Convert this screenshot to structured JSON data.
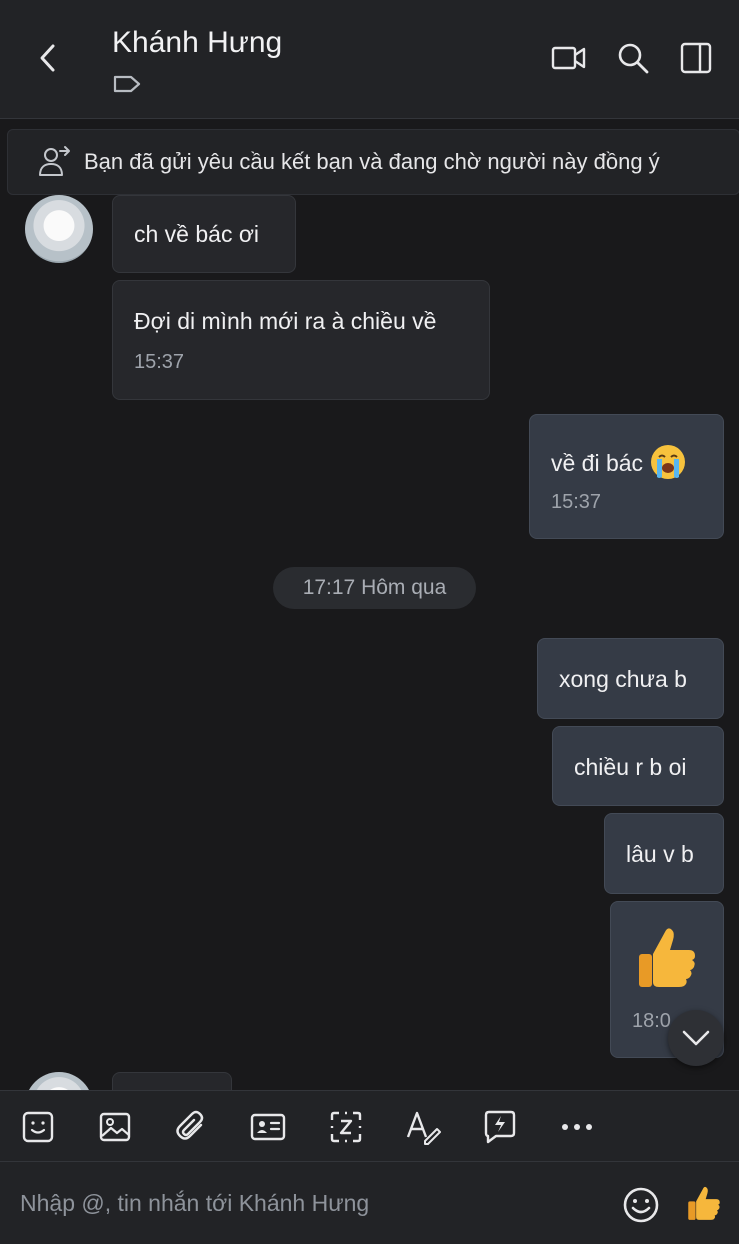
{
  "header": {
    "title": "Khánh Hưng",
    "icons": [
      "back-icon",
      "tag-icon",
      "video-call-icon",
      "search-icon",
      "side-panel-icon"
    ]
  },
  "notice": {
    "text": "Bạn đã gửi yêu cầu kết bạn và đang chờ người này đồng ý"
  },
  "messages": [
    {
      "direction": "incoming",
      "text": "ch về bác ơi"
    },
    {
      "direction": "incoming",
      "text": "Đợi di mình mới ra à chiều về",
      "time": "15:37"
    },
    {
      "direction": "outgoing",
      "text": "về đi bác",
      "emoji": "loudly-crying-face",
      "time": "15:37"
    },
    {
      "direction": "outgoing",
      "text": "xong chưa b"
    },
    {
      "direction": "outgoing",
      "text": "chiều r b oi"
    },
    {
      "direction": "outgoing",
      "text": "lâu v b"
    },
    {
      "direction": "outgoing",
      "emoji": "thumbs-up",
      "time": "18:0"
    }
  ],
  "date_separator": "17:17 Hôm qua",
  "toolbar": {
    "items": [
      "sticker-icon",
      "image-icon",
      "attachment-icon",
      "contact-card-icon",
      "screenshot-icon",
      "text-format-icon",
      "quick-message-icon",
      "more-icon"
    ]
  },
  "composer": {
    "placeholder": "Nhập @, tin nhắn tới Khánh Hưng"
  },
  "colors": {
    "background": "#19191b",
    "header": "#222326",
    "incoming_bubble": "#26272b",
    "outgoing_bubble": "#353b46"
  }
}
